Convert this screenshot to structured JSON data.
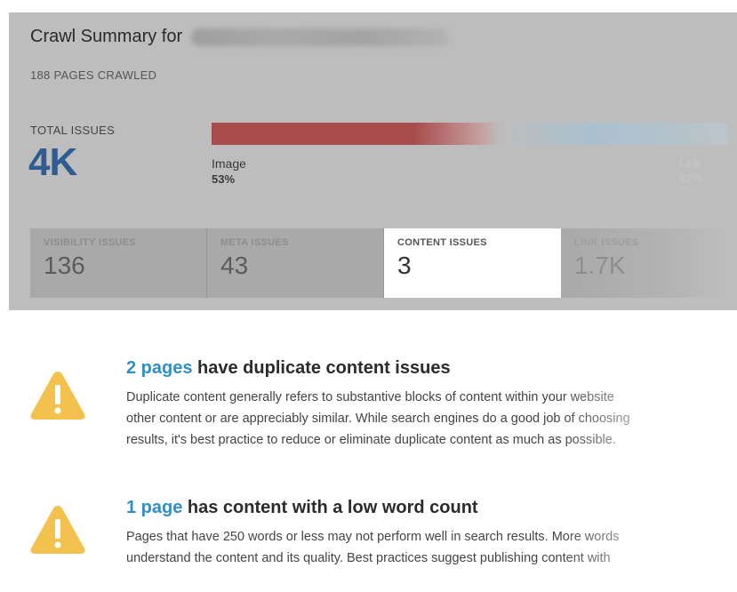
{
  "summary": {
    "title_prefix": "Crawl Summary for",
    "pages_crawled": "188 PAGES CRAWLED",
    "total_issues_label": "TOTAL ISSUES",
    "total_issues_value": "4K"
  },
  "issue_breakdown": {
    "segments": [
      {
        "label": "Image",
        "percent_text": "53%",
        "percent": 53,
        "color": "#a94b4b"
      },
      {
        "label": "Link",
        "percent_text": "42%",
        "percent": 42,
        "color": "#aac0cf"
      }
    ]
  },
  "tabs": [
    {
      "label": "VISIBILITY ISSUES",
      "count": "136",
      "active": false
    },
    {
      "label": "META ISSUES",
      "count": "43",
      "active": false
    },
    {
      "label": "CONTENT ISSUES",
      "count": "3",
      "active": true
    },
    {
      "label": "LINK ISSUES",
      "count": "1.7K",
      "active": false
    }
  ],
  "issues": [
    {
      "count_text": "2 pages",
      "title_rest": " have duplicate content issues",
      "desc_lines": [
        "Duplicate content generally refers to substantive blocks of content within your website",
        "other content or are appreciably similar. While search engines do a good job of choosing",
        "results, it's best practice to reduce or eliminate duplicate content as much as possible."
      ],
      "icon": "warning-icon"
    },
    {
      "count_text": "1 page",
      "title_rest": " has content with a low word count",
      "desc_lines": [
        "Pages that have 250 words or less may not perform well in search results. More words",
        "understand the content and its quality. Best practices suggest publishing content with"
      ],
      "icon": "warning-icon"
    }
  ],
  "colors": {
    "accent_blue": "#2f5d92",
    "link_blue": "#2f8fc7",
    "warning_yellow": "#f2c14e",
    "image_bar_red": "#a94b4b"
  }
}
